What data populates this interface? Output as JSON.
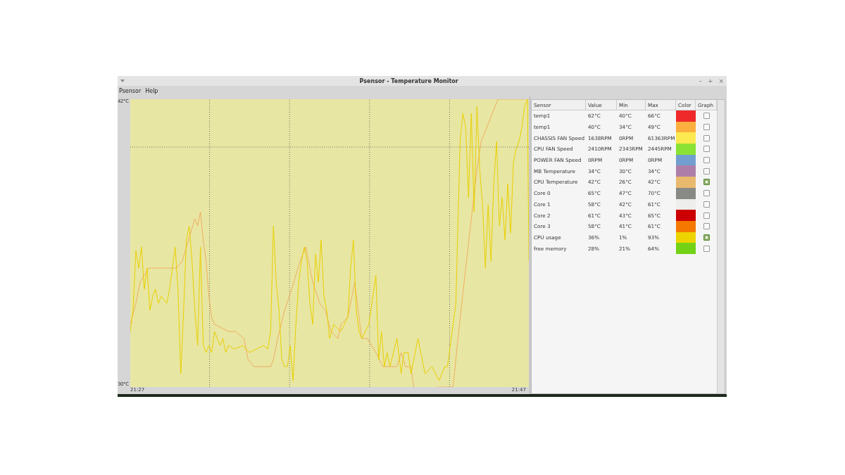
{
  "window": {
    "title": "Psensor - Temperature Monitor",
    "controls": [
      "–",
      "+",
      "×"
    ]
  },
  "menu": [
    "Psensor",
    "Help"
  ],
  "graph": {
    "y_max": "42°C",
    "y_min": "30°C",
    "x_start": "21:27",
    "x_end": "21:47"
  },
  "table": {
    "columns": [
      "Sensor",
      "Value",
      "Min",
      "Max",
      "Color",
      "Graph"
    ],
    "sensors": [
      {
        "name": "temp1",
        "value": "62°C",
        "min": "40°C",
        "max": "66°C",
        "color": "#ef2929",
        "graph": false
      },
      {
        "name": "temp1",
        "value": "40°C",
        "min": "34°C",
        "max": "49°C",
        "color": "#fcaf3e",
        "graph": false
      },
      {
        "name": "CHASSIS FAN Speed",
        "value": "1638RPM",
        "min": "0RPM",
        "max": "61363RPM",
        "color": "#fce94f",
        "graph": false
      },
      {
        "name": "CPU FAN Speed",
        "value": "2410RPM",
        "min": "2343RPM",
        "max": "2445RPM",
        "color": "#8ae234",
        "graph": false
      },
      {
        "name": "POWER FAN Speed",
        "value": "0RPM",
        "min": "0RPM",
        "max": "0RPM",
        "color": "#729fcf",
        "graph": false
      },
      {
        "name": "MB Temperature",
        "value": "34°C",
        "min": "30°C",
        "max": "34°C",
        "color": "#ad7fa8",
        "graph": false
      },
      {
        "name": "CPU Temperature",
        "value": "42°C",
        "min": "26°C",
        "max": "42°C",
        "color": "#e9b96e",
        "graph": true
      },
      {
        "name": "Core 0",
        "value": "65°C",
        "min": "47°C",
        "max": "70°C",
        "color": "#888a85",
        "graph": false
      },
      {
        "name": "Core 1",
        "value": "58°C",
        "min": "42°C",
        "max": "61°C",
        "color": "#eeeeec",
        "graph": false
      },
      {
        "name": "Core 2",
        "value": "61°C",
        "min": "43°C",
        "max": "65°C",
        "color": "#cc0000",
        "graph": false
      },
      {
        "name": "Core 3",
        "value": "58°C",
        "min": "41°C",
        "max": "61°C",
        "color": "#f57900",
        "graph": false
      },
      {
        "name": "CPU usage",
        "value": "36%",
        "min": "1%",
        "max": "93%",
        "color": "#edd400",
        "graph": true
      },
      {
        "name": "free memory",
        "value": "28%",
        "min": "21%",
        "max": "64%",
        "color": "#73d216",
        "graph": false
      }
    ]
  }
}
